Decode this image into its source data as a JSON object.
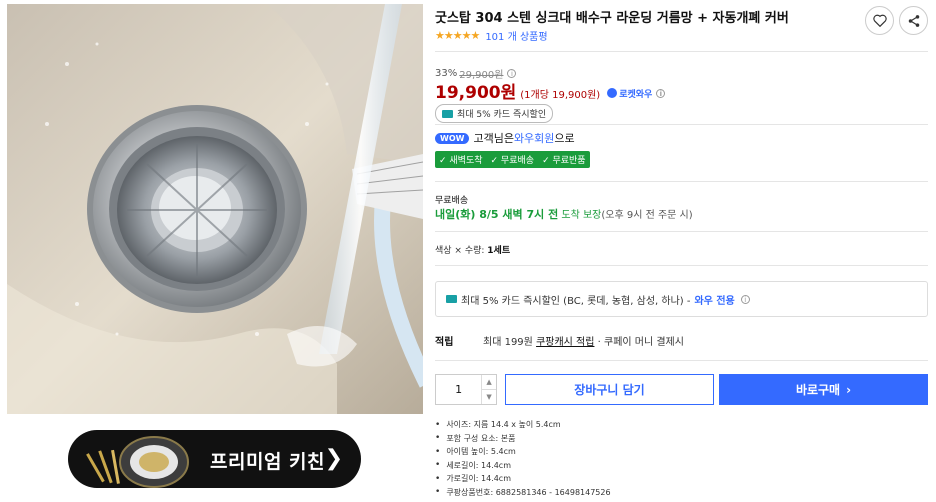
{
  "product": {
    "title": "굿스탑 304 스텐 싱크대 배수구 라운딩 거름망 + 자동개폐 커버",
    "review_count": "101 개 상품평",
    "stars": "★★★★★",
    "rating": 4.5
  },
  "price": {
    "discount": "33%",
    "original": "29,900원",
    "sale": "19,900원",
    "unit": "(1개당 19,900원)",
    "badge": "로켓와우"
  },
  "card_benefit": "최대 5% 카드 즉시할인",
  "wow": {
    "badge": "WOW",
    "prefix": "고객님은",
    "link": "와우회원",
    "suffix": "으로"
  },
  "benefits": [
    "✓ 새벽도착",
    "✓ 무료배송",
    "✓ 무료반품"
  ],
  "shipping": {
    "label": "무료배송",
    "date_strong": "내일(화) 8/5 새벽 7시 전",
    "date_suffix": "도착 보장",
    "note": "(오후 9시 전 주문 시)"
  },
  "option": {
    "label": "색상 × 수량:",
    "value": "1세트"
  },
  "promo": {
    "text": "최대 5% 카드 즉시할인 (BC, 롯데, 농협, 삼성, 하나) -",
    "wow": "와우 전용"
  },
  "points": {
    "label": "적립",
    "text1": "최대 199원",
    "link": "쿠팡캐시 적립",
    "text2": "· 쿠페이 머니 결제시"
  },
  "quantity": "1",
  "buttons": {
    "cart": "장바구니 담기",
    "buy": "바로구매"
  },
  "specs": [
    "사이즈: 지름 14.4 x 높이 5.4cm",
    "포함 구성 요소: 본품",
    "아이템 높이: 5.4cm",
    "세로길이: 14.4cm",
    "가로길이: 14.4cm",
    "쿠팡상품번호: 6882581346 - 16498147526"
  ],
  "banner": {
    "text": "프리미엄 키친",
    "arrow": "❯"
  },
  "colors": {
    "accent": "#346aff",
    "price_red": "#ae0000",
    "green": "#1a9c3b"
  },
  "icons": [
    "heart-icon",
    "share-icon",
    "card-icon",
    "rocket-icon",
    "info-icon",
    "chevron-right-icon"
  ]
}
